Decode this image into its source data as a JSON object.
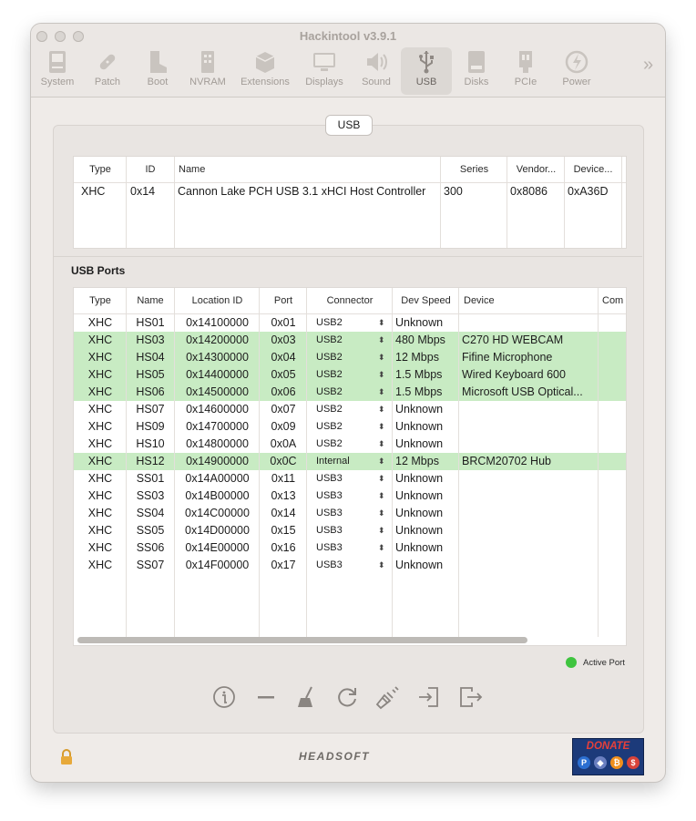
{
  "window": {
    "title": "Hackintool v3.9.1"
  },
  "toolbar": {
    "items": [
      {
        "label": "System",
        "icon": "system-icon"
      },
      {
        "label": "Patch",
        "icon": "patch-icon"
      },
      {
        "label": "Boot",
        "icon": "boot-icon"
      },
      {
        "label": "NVRAM",
        "icon": "nvram-icon"
      },
      {
        "label": "Extensions",
        "icon": "extensions-icon"
      },
      {
        "label": "Displays",
        "icon": "displays-icon"
      },
      {
        "label": "Sound",
        "icon": "sound-icon"
      },
      {
        "label": "USB",
        "icon": "usb-icon",
        "active": true
      },
      {
        "label": "Disks",
        "icon": "disks-icon"
      },
      {
        "label": "PCIe",
        "icon": "pcie-icon"
      },
      {
        "label": "Power",
        "icon": "power-icon"
      }
    ],
    "overflow": "»"
  },
  "tab": {
    "label": "USB"
  },
  "controllers": {
    "headers": [
      "Type",
      "ID",
      "Name",
      "Series",
      "Vendor...",
      "Device..."
    ],
    "rows": [
      [
        "XHC",
        "0x14",
        "Cannon Lake PCH USB 3.1 xHCI Host Controller",
        "300",
        "0x8086",
        "0xA36D"
      ]
    ]
  },
  "ports": {
    "title": "USB Ports",
    "headers": [
      "Type",
      "Name",
      "Location ID",
      "Port",
      "Connector",
      "Dev Speed",
      "Device",
      "Com"
    ],
    "rows": [
      {
        "type": "XHC",
        "name": "HS01",
        "location": "0x14100000",
        "port": "0x01",
        "connector": "USB2",
        "speed": "Unknown",
        "device": "",
        "active": false
      },
      {
        "type": "XHC",
        "name": "HS03",
        "location": "0x14200000",
        "port": "0x03",
        "connector": "USB2",
        "speed": "480 Mbps",
        "device": "C270 HD WEBCAM",
        "active": true
      },
      {
        "type": "XHC",
        "name": "HS04",
        "location": "0x14300000",
        "port": "0x04",
        "connector": "USB2",
        "speed": "12 Mbps",
        "device": "Fifine Microphone",
        "active": true
      },
      {
        "type": "XHC",
        "name": "HS05",
        "location": "0x14400000",
        "port": "0x05",
        "connector": "USB2",
        "speed": "1.5 Mbps",
        "device": "Wired Keyboard 600",
        "active": true
      },
      {
        "type": "XHC",
        "name": "HS06",
        "location": "0x14500000",
        "port": "0x06",
        "connector": "USB2",
        "speed": "1.5 Mbps",
        "device": "Microsoft USB Optical...",
        "active": true
      },
      {
        "type": "XHC",
        "name": "HS07",
        "location": "0x14600000",
        "port": "0x07",
        "connector": "USB2",
        "speed": "Unknown",
        "device": "",
        "active": false
      },
      {
        "type": "XHC",
        "name": "HS09",
        "location": "0x14700000",
        "port": "0x09",
        "connector": "USB2",
        "speed": "Unknown",
        "device": "",
        "active": false
      },
      {
        "type": "XHC",
        "name": "HS10",
        "location": "0x14800000",
        "port": "0x0A",
        "connector": "USB2",
        "speed": "Unknown",
        "device": "",
        "active": false
      },
      {
        "type": "XHC",
        "name": "HS12",
        "location": "0x14900000",
        "port": "0x0C",
        "connector": "Internal",
        "speed": "12 Mbps",
        "device": "BRCM20702 Hub",
        "active": true
      },
      {
        "type": "XHC",
        "name": "SS01",
        "location": "0x14A00000",
        "port": "0x11",
        "connector": "USB3",
        "speed": "Unknown",
        "device": "",
        "active": false
      },
      {
        "type": "XHC",
        "name": "SS03",
        "location": "0x14B00000",
        "port": "0x13",
        "connector": "USB3",
        "speed": "Unknown",
        "device": "",
        "active": false
      },
      {
        "type": "XHC",
        "name": "SS04",
        "location": "0x14C00000",
        "port": "0x14",
        "connector": "USB3",
        "speed": "Unknown",
        "device": "",
        "active": false
      },
      {
        "type": "XHC",
        "name": "SS05",
        "location": "0x14D00000",
        "port": "0x15",
        "connector": "USB3",
        "speed": "Unknown",
        "device": "",
        "active": false
      },
      {
        "type": "XHC",
        "name": "SS06",
        "location": "0x14E00000",
        "port": "0x16",
        "connector": "USB3",
        "speed": "Unknown",
        "device": "",
        "active": false
      },
      {
        "type": "XHC",
        "name": "SS07",
        "location": "0x14F00000",
        "port": "0x17",
        "connector": "USB3",
        "speed": "Unknown",
        "device": "",
        "active": false
      }
    ]
  },
  "legend": {
    "label": "Active Port",
    "color": "#3fc43f"
  },
  "bottom_actions": [
    "info-icon",
    "remove-icon",
    "clear-icon",
    "refresh-icon",
    "inject-icon",
    "import-icon",
    "export-icon"
  ],
  "footer": {
    "brand": "HEADSOFT",
    "donate": "DONATE"
  },
  "colors": {
    "active_row": "#c8ebc3"
  }
}
